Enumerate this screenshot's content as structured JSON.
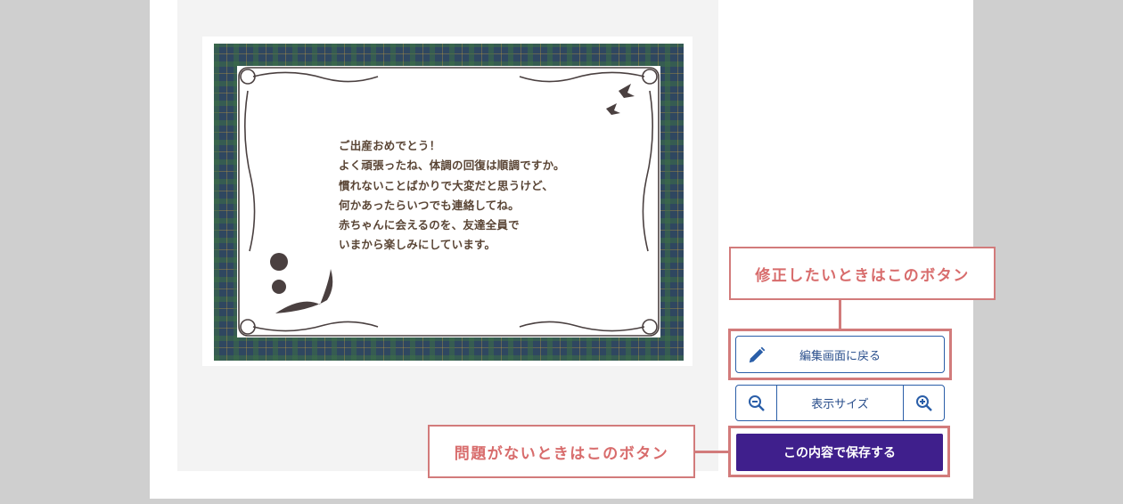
{
  "card": {
    "message_lines": [
      "ご出産おめでとう！",
      "よく頑張ったね、体調の回復は順調ですか。",
      "慣れないことばかりで大変だと思うけど、",
      "何かあったらいつでも連絡してね。",
      "赤ちゃんに会えるのを、友達全員で",
      "いまから楽しみにしています。"
    ]
  },
  "actions": {
    "edit_label": "編集画面に戻る",
    "zoom_label": "表示サイズ",
    "save_label": "この内容で保存する"
  },
  "callouts": {
    "edit_hint": "修正したいときはこのボタン",
    "save_hint": "問題がないときはこのボタン"
  },
  "icons": {
    "edit": "pencil-icon",
    "zoom_out": "zoom-out-icon",
    "zoom_in": "zoom-in-icon"
  },
  "colors": {
    "accent": "#3f1f8c",
    "button_border": "#2a5ea8",
    "highlight": "#d27b7b",
    "message_text": "#5a4535"
  }
}
